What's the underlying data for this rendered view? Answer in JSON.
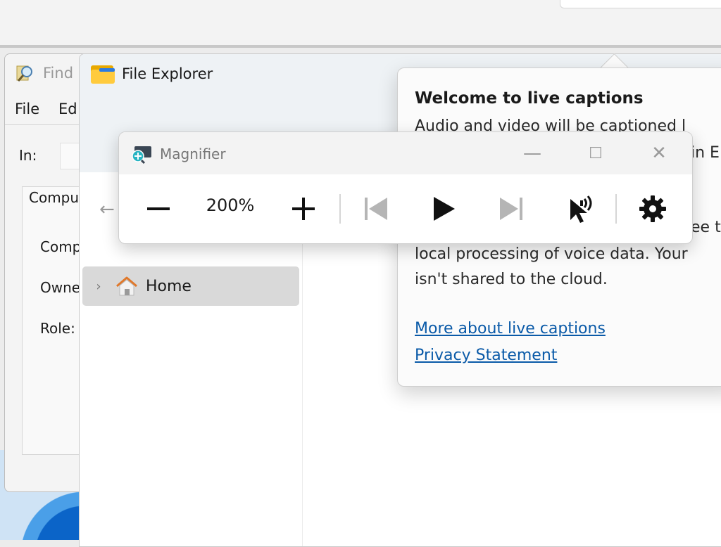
{
  "find_window": {
    "title": "Find",
    "menu": [
      "File",
      "Ed"
    ],
    "in_label": "In:",
    "tab_label": "Comput",
    "fields": [
      "Comp",
      "Owne",
      "Role:"
    ]
  },
  "explorer": {
    "title": "File Explorer",
    "nav": {
      "home_label": "Home"
    }
  },
  "live_captions": {
    "title": "Welcome to live captions",
    "lines": [
      "Audio and video will be captioned l",
      "in E",
      "ee t",
      "local processing of voice data. Your",
      "isn't shared to the cloud."
    ],
    "links": [
      "More about live captions",
      "Privacy Statement"
    ]
  },
  "magnifier": {
    "title": "Magnifier",
    "zoom_level": "200%",
    "window_buttons": {
      "minimize": "—",
      "maximize": "☐",
      "close": "✕"
    }
  },
  "colors": {
    "link": "#0a5aa8",
    "folder": "#ffcb3d",
    "accent": "#2b7be0"
  }
}
